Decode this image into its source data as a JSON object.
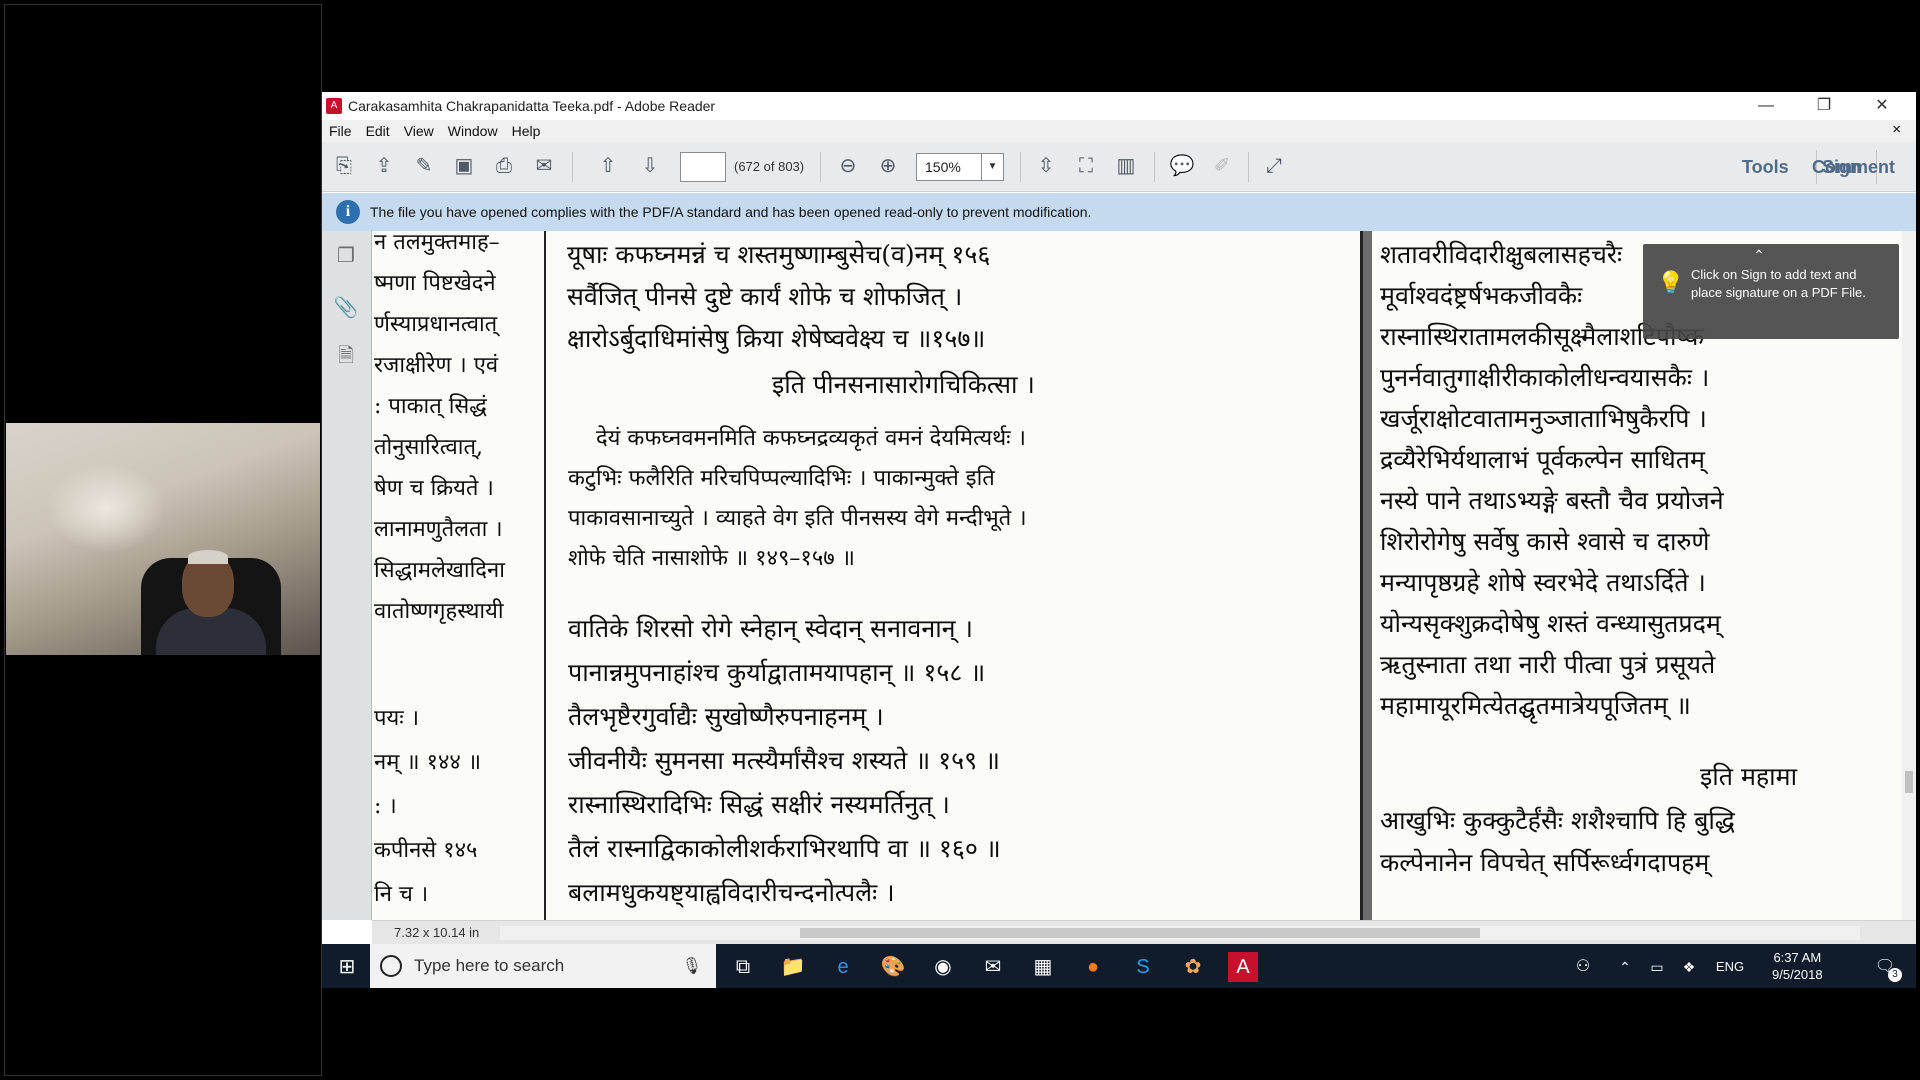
{
  "window": {
    "title": "Carakasamhita Chakrapanidatta Teeka.pdf - Adobe Reader",
    "minimize": "—",
    "restore": "❐",
    "close": "✕"
  },
  "menu": {
    "items": [
      "File",
      "Edit",
      "View",
      "Window",
      "Help"
    ],
    "close": "×"
  },
  "toolbar": {
    "page_value": "",
    "page_count": "(672 of 803)",
    "zoom": "150%",
    "tools": "Tools",
    "sign": "Sign",
    "comment": "Comment"
  },
  "infobar": {
    "message": "The file you have opened complies with the PDF/A standard and has been opened read-only to prevent modification."
  },
  "tooltip": {
    "text": "Click on Sign to add text and place signature on a PDF File."
  },
  "status": {
    "page_size": "7.32 x 10.14 in"
  },
  "pdf": {
    "col_a": [
      "न तलमुक्तमाह–",
      "ष्मणा पिष्टखेदने",
      "र्णस्याप्रधानत्वात्",
      "रजाक्षीरेण । एवं",
      ": पाकात् सिद्धं",
      "तोनुसारित्वात्,",
      "षेण च क्रियते ।",
      "लानामणुतैलता ।",
      "सिद्धामलेखादिना",
      "वातोष्णगृहस्थायी",
      "",
      "पयः ।",
      "नम् ॥ १४४ ॥",
      ": ।",
      "कपीनसे १४५",
      "नि च ।"
    ],
    "col_b_verse1": [
      "यूषाः कफघ्नमन्नं च शस्तमुष्णाम्बुसेच(व)नम् १५६",
      "सर्वैजित् पीनसे दुष्टे कार्यं शोफे च शोफजित् ।",
      "क्षारोऽर्बुदाधिमांसेषु क्रिया शेषेष्ववेक्ष्य च ॥१५७॥",
      "इति पीनसनासारोगचिकित्सा ।"
    ],
    "col_b_comment": [
      "देयं कफघ्नवमनमिति कफघ्नद्रव्यकृतं वमनं देयमित्यर्थः ।",
      "कटुभिः फलैरिति मरिचपिप्पल्यादिभिः । पाकान्मुक्ते इति",
      "पाकावसानाच्युते । व्याहते वेग इति पीनसस्य वेगे मन्दीभूते ।",
      "शोफे चेति नासाशोफे ॥ १४९–१५७ ॥"
    ],
    "col_b_verse2": [
      "वातिके शिरसो रोगे स्नेहान् स्वेदान् सनावनान् ।",
      "पानान्नमुपनाहांश्च कुर्याद्वातामयापहान् ॥ १५८ ॥",
      "तैलभृष्टैरगुर्वाद्यैः सुखोष्णैरुपनाहनम् ।",
      "जीवनीयैः सुमनसा मत्स्यैर्मांसैश्च शस्यते ॥ १५९ ॥",
      "रास्नास्थिरादिभिः सिद्धं सक्षीरं नस्यमर्तिनुत् ।",
      "तैलं रास्नाद्विकाकोलीशर्कराभिरथापि वा ॥ १६० ॥",
      "बलामधुकयष्ट्याह्वविदारीचन्दनोत्पलैः ।"
    ],
    "col_c": [
      "शतावरीविदारीक्षुबलासहचरैः",
      "मूर्वाश्वदंष्ट्रर्षभकजीवकैः",
      "रास्नास्थिरातामलकीसूक्ष्मैलाशटिपौष्क",
      "पुनर्नवातुगाक्षीरीकाकोलीधन्वयासकैः ।",
      "खर्जूराक्षोटवातामनुञ्जाताभिषुकैरपि ।",
      "द्रव्यैरेभिर्यथालाभं पूर्वकल्पेन साधितम्",
      "नस्ये पाने तथाऽभ्यङ्गे बस्तौ चैव प्रयोजने",
      "शिरोरोगेषु सर्वेषु कासे श्वासे च दारुणे",
      "मन्यापृष्ठग्रहे शोषे स्वरभेदे तथाऽर्दिते ।",
      "योन्यसृक्शुक्रदोषेषु शस्तं वन्ध्यासुतप्रदम्",
      "ऋतुस्नाता तथा नारी पीत्वा पुत्रं प्रसूयते",
      "महामायूरमित्येतद्घृतमात्रेयपूजितम् ॥",
      "इति महामा",
      "आखुभिः कुक्कुटैर्हंसैः शशैश्चापि हि बुद्धि",
      "कल्पेनानेन विपचेत् सर्पिरूर्ध्वगदापहम्"
    ]
  },
  "taskbar": {
    "search_placeholder": "Type here to search",
    "lang": "ENG",
    "time": "6:37 AM",
    "date": "9/5/2018",
    "notif_count": "3"
  },
  "colors": {
    "infobar": "#c5daee",
    "taskbar": "#101c2b",
    "accent": "#4f6b8a"
  }
}
